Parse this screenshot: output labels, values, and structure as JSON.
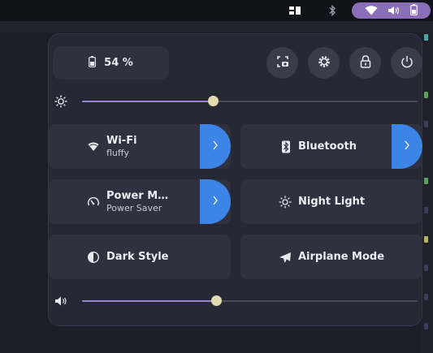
{
  "topbar": {
    "icons": [
      "window-switcher-icon",
      "bluetooth-icon"
    ],
    "status_icons": [
      "wifi-icon",
      "volume-icon",
      "battery-icon"
    ],
    "accent": "#8a6fb8"
  },
  "quick_settings": {
    "battery": {
      "icon": "battery-icon",
      "label": "54 %"
    },
    "actions": [
      {
        "name": "screenshot",
        "icon": "screenshot-icon"
      },
      {
        "name": "settings",
        "icon": "settings-gear-icon"
      },
      {
        "name": "lock",
        "icon": "lock-icon"
      },
      {
        "name": "power",
        "icon": "power-icon"
      }
    ],
    "brightness": {
      "icon": "brightness-icon",
      "value": 0.39
    },
    "volume": {
      "icon": "volume-icon",
      "value": 0.4
    },
    "tiles": [
      {
        "id": "wifi",
        "icon": "wifi-icon",
        "title": "Wi-Fi",
        "subtitle": "fluffy",
        "has_menu": true
      },
      {
        "id": "bluetooth",
        "icon": "bluetooth-icon",
        "title": "Bluetooth",
        "subtitle": "",
        "has_menu": true
      },
      {
        "id": "power-mode",
        "icon": "power-mode-icon",
        "title": "Power M…",
        "subtitle": "Power Saver",
        "has_menu": true
      },
      {
        "id": "night-light",
        "icon": "night-light-icon",
        "title": "Night Light",
        "subtitle": "",
        "has_menu": false
      },
      {
        "id": "dark-style",
        "icon": "dark-style-icon",
        "title": "Dark Style",
        "subtitle": "",
        "has_menu": false
      },
      {
        "id": "airplane",
        "icon": "airplane-icon",
        "title": "Airplane Mode",
        "subtitle": "",
        "has_menu": false
      }
    ],
    "colors": {
      "panel": "#262834",
      "tile": "#2f313f",
      "menu_arrow": "#3c84e6",
      "slider_fill": "#9a88d6",
      "slider_knob": "#e3dbb0"
    }
  }
}
